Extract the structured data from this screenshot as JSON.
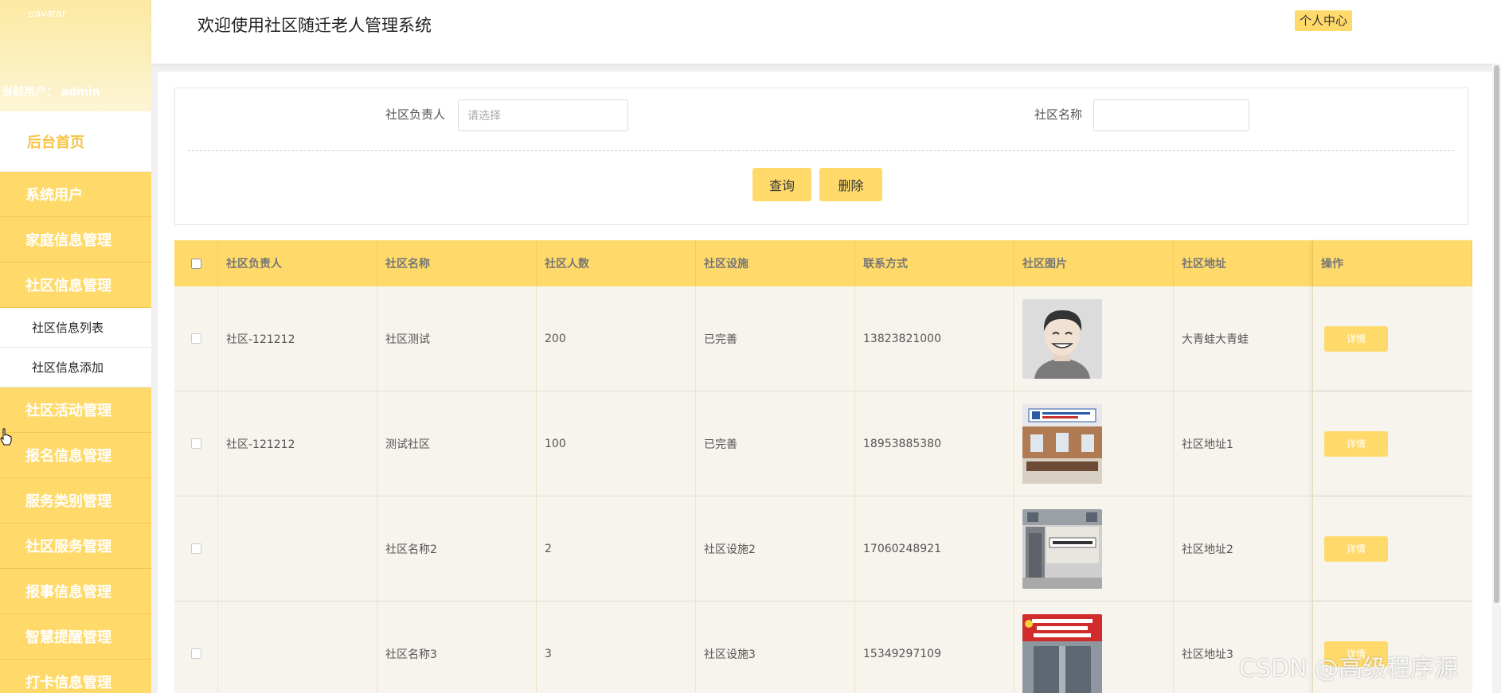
{
  "sidebar": {
    "avatar_alt": "avatar",
    "current_user": "当前用户： admin",
    "home": "后台首页",
    "items": [
      {
        "label": "系统用户"
      },
      {
        "label": "家庭信息管理"
      },
      {
        "label": "社区信息管理"
      },
      {
        "label": "社区活动管理"
      },
      {
        "label": "报名信息管理"
      },
      {
        "label": "服务类别管理"
      },
      {
        "label": "社区服务管理"
      },
      {
        "label": "报事信息管理"
      },
      {
        "label": "智慧提醒管理"
      },
      {
        "label": "打卡信息管理"
      }
    ],
    "subitems": [
      {
        "label": "社区信息列表"
      },
      {
        "label": "社区信息添加"
      }
    ]
  },
  "header": {
    "title": "欢迎使用社区随迁老人管理系统",
    "personal_center": "个人中心"
  },
  "search": {
    "manager_label": "社区负责人",
    "manager_placeholder": "请选择",
    "name_label": "社区名称",
    "name_value": "",
    "query_button": "查询",
    "delete_button": "删除"
  },
  "table": {
    "headers": [
      "社区负责人",
      "社区名称",
      "社区人数",
      "社区设施",
      "联系方式",
      "社区图片",
      "社区地址",
      "操作"
    ],
    "rows": [
      {
        "manager": "社区-121212",
        "name": "社区测试",
        "count": "200",
        "facility": "已完善",
        "phone": "13823821000",
        "image": "cartoon-avatar",
        "address": "大青蛙大青蛙",
        "action": "详情"
      },
      {
        "manager": "社区-121212",
        "name": "测试社区",
        "count": "100",
        "facility": "已完善",
        "phone": "18953885380",
        "image": "service-center-interior",
        "address": "社区地址1",
        "action": "详情"
      },
      {
        "manager": "",
        "name": "社区名称2",
        "count": "2",
        "facility": "社区设施2",
        "phone": "17060248921",
        "image": "building-entrance",
        "address": "社区地址2",
        "action": "详情"
      },
      {
        "manager": "",
        "name": "社区名称3",
        "count": "3",
        "facility": "社区设施3",
        "phone": "15349297109",
        "image": "storefront-red-sign",
        "address": "社区地址3",
        "action": "详情"
      }
    ]
  },
  "watermark": "CSDN @高级程序源"
}
